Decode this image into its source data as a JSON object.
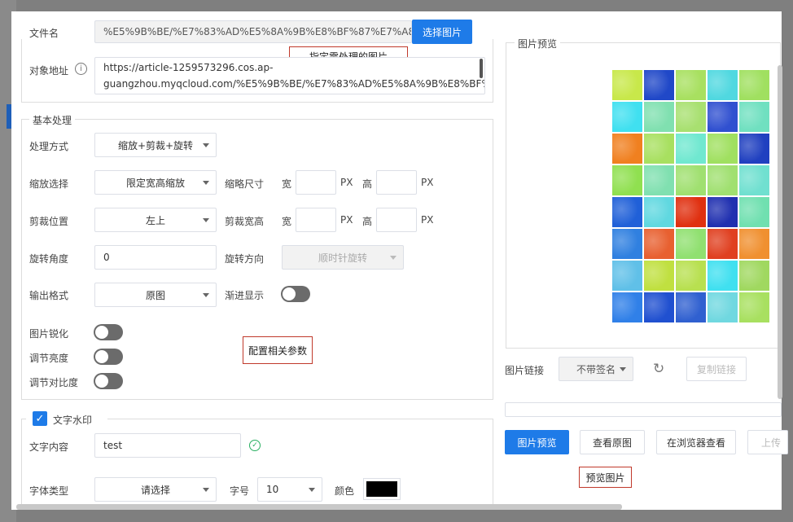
{
  "file": {
    "label": "文件名",
    "value": "%E5%9B%BE/%E7%83%AD%E5%8A%9B%E8%BF%87%E7%A8%",
    "choose_button": "选择图片"
  },
  "object": {
    "label": "对象地址",
    "line1": "https://article-1259573296.cos.ap-",
    "line2": "guangzhou.myqcloud.com/%E5%9B%BE/%E7%83%AD%E5%8A%9B%E8%BF%8"
  },
  "basic": {
    "legend": "基本处理",
    "method_label": "处理方式",
    "method_value": "缩放+剪裁+旋转",
    "scale_label": "缩放选择",
    "scale_value": "限定宽高缩放",
    "thumb_label": "缩略尺寸",
    "w_label": "宽",
    "h_label": "高",
    "unit": "PX",
    "crop_pos_label": "剪裁位置",
    "crop_pos_value": "左上",
    "crop_wh_label": "剪裁宽高",
    "rotate_label": "旋转角度",
    "rotate_value": "0",
    "rotate_dir_label": "旋转方向",
    "rotate_dir_value": "顺时针旋转",
    "format_label": "输出格式",
    "format_value": "原图",
    "progressive_label": "渐进显示",
    "sharpen_label": "图片锐化",
    "brightness_label": "调节亮度",
    "contrast_label": "调节对比度"
  },
  "watermark": {
    "legend": "文字水印",
    "content_label": "文字内容",
    "content_value": "test",
    "font_label": "字体类型",
    "font_value": "请选择",
    "size_label": "字号",
    "size_value": "10",
    "color_label": "颜色",
    "color_hex": "#000000"
  },
  "preview": {
    "legend": "图片预览",
    "link_label": "图片链接",
    "link_select": "不带签名",
    "copy_button": "复制链接",
    "btn_preview": "图片预览",
    "btn_original": "查看原图",
    "btn_browser": "在浏览器查看",
    "btn_upload": "上传"
  },
  "annotations": {
    "select_image": "指定需处理的图片",
    "config_params": "配置相关参数",
    "preview_image": "预览图片"
  },
  "tiles": [
    [
      "#c8e84a",
      "#2048c8",
      "#a8e060",
      "#50d8e0",
      "#a0e060"
    ],
    [
      "#40e0f0",
      "#80e0b0",
      "#a8e070",
      "#3050d0",
      "#70e0c0"
    ],
    [
      "#f08020",
      "#a8e060",
      "#70e8d0",
      "#a0e060",
      "#2040c0"
    ],
    [
      "#90e050",
      "#80e0b0",
      "#a0e070",
      "#a0e070",
      "#70e0d0"
    ],
    [
      "#2060d8",
      "#60d8e0",
      "#e03010",
      "#2030b0",
      "#70e0b0"
    ],
    [
      "#3080e0",
      "#e86030",
      "#90e070",
      "#e04020",
      "#f09030"
    ],
    [
      "#60c0e8",
      "#c0e040",
      "#b8e050",
      "#40e0f0",
      "#a0d860"
    ],
    [
      "#3080e8",
      "#2050d0",
      "#3060d0",
      "#70d8e0",
      "#a8e060"
    ]
  ],
  "colors": {
    "primary": "#1e7be8",
    "annotation_border": "#c0392b",
    "success": "#27ae60"
  }
}
